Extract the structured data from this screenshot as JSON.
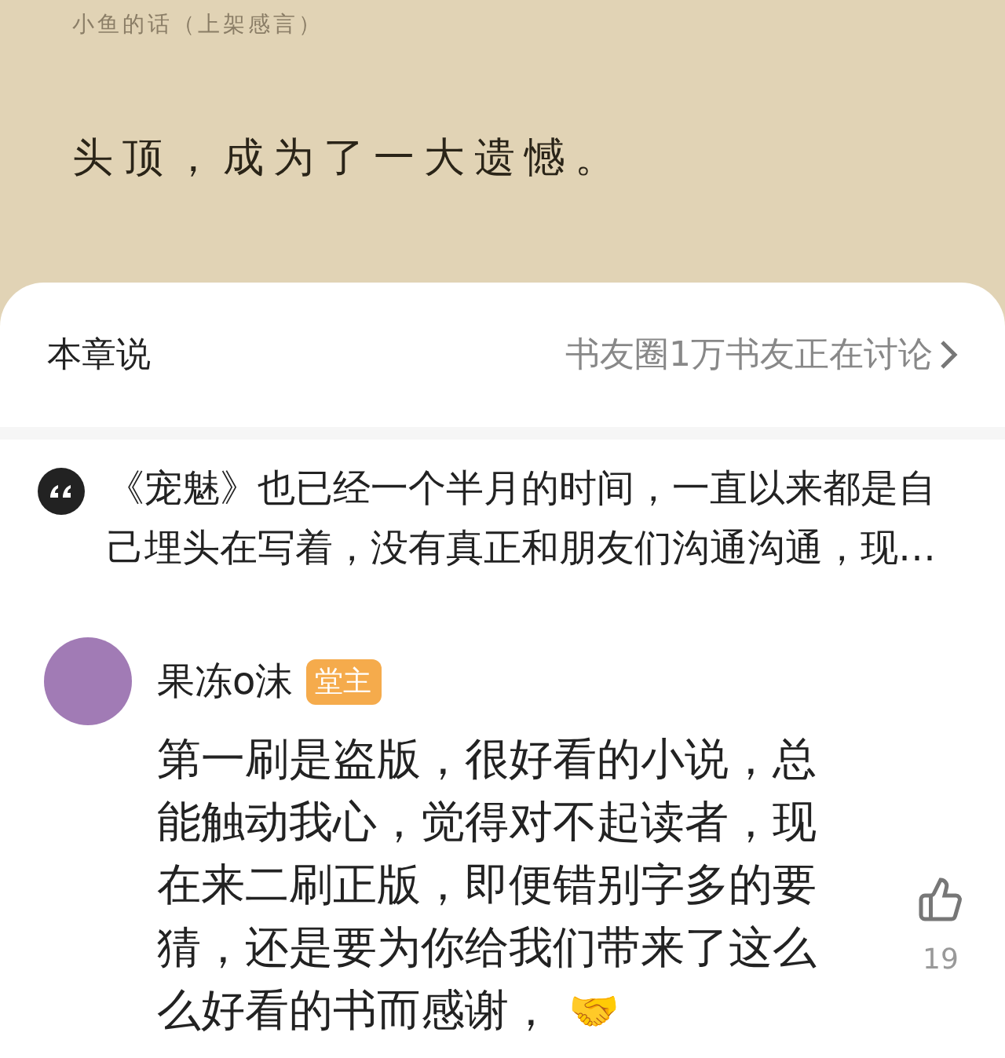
{
  "reader": {
    "chapter_title": "小鱼的话（上架感言）",
    "text_line": "头顶，成为了一大遗憾。"
  },
  "chapter_comments": {
    "title": "本章说",
    "community_link": "书友圈1万书友正在讨论"
  },
  "author_note": {
    "text": "《宠魅》也已经一个半月的时间，一直以来都是自己埋头在写着，没有真正和朋友们沟通沟通，现…"
  },
  "comments": [
    {
      "user": "果冻o沫",
      "badge": "堂主",
      "text": "第一刷是盗版，很好看的小说，总能触动我心，觉得对不起读者，现在来二刷正版，即便错别字多的要猜，还是要为你给我们带来了这么么好看的书而感谢，",
      "emoji": "🤝",
      "likes": "19"
    }
  ]
}
